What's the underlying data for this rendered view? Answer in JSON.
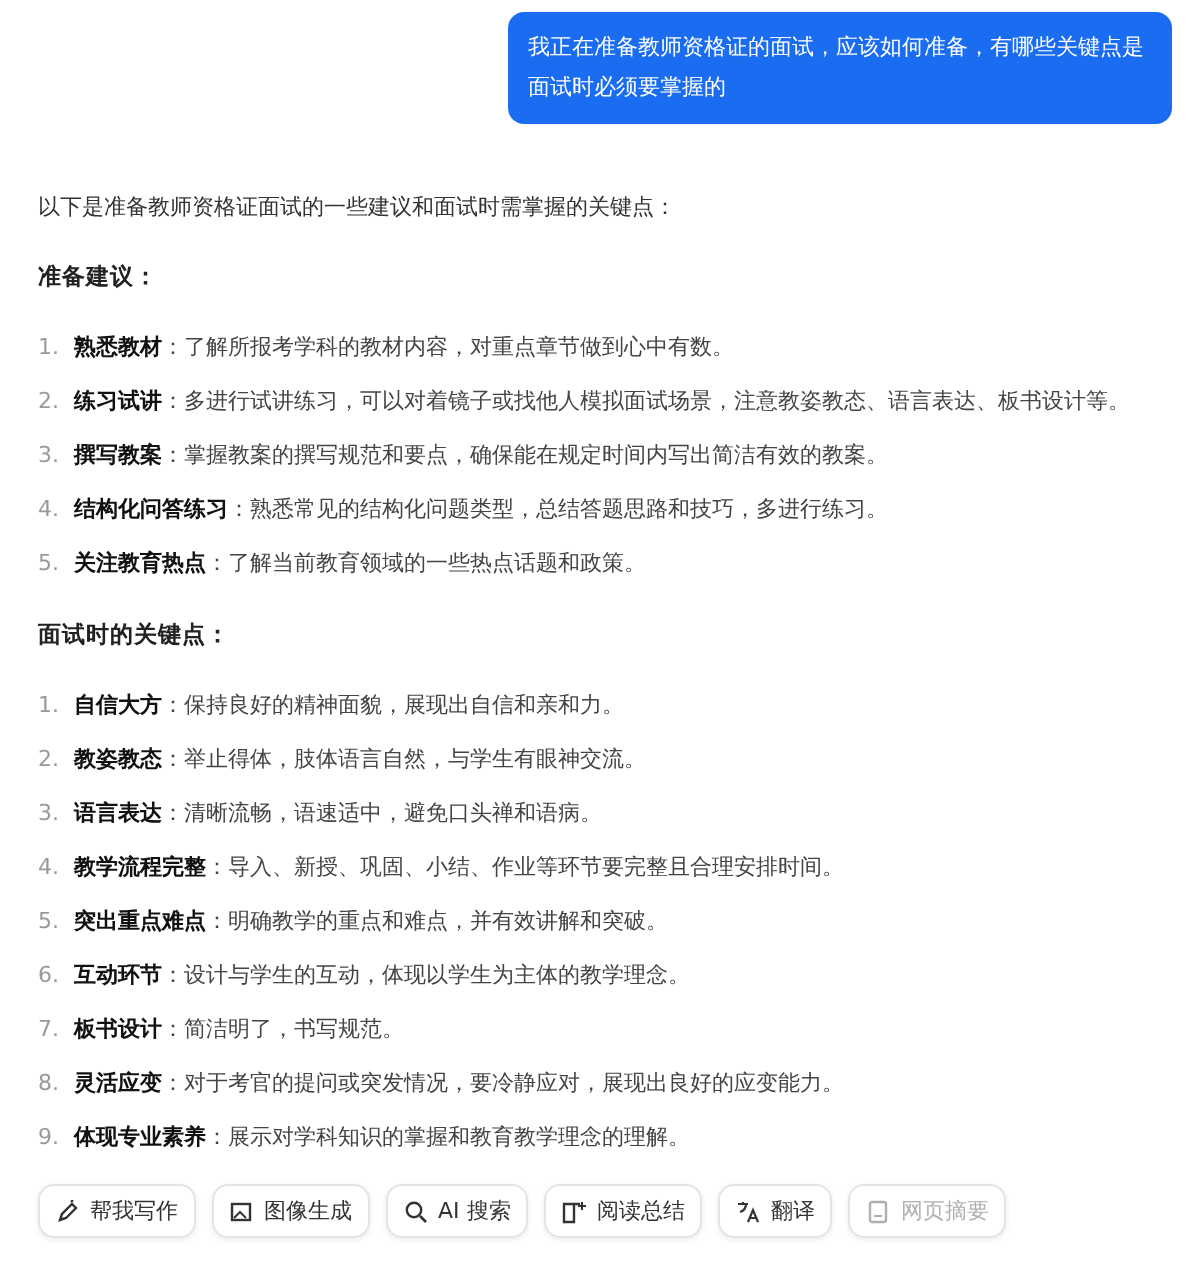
{
  "user_message": "我正在准备教师资格证的面试，应该如何准备，有哪些关键点是面试时必须要掌握的",
  "intro": "以下是准备教师资格证面试的一些建议和面试时需掌握的关键点：",
  "sections": [
    {
      "heading": "准备建议：",
      "items": [
        {
          "number": "1.",
          "term": "熟悉教材",
          "text": "：了解所报考学科的教材内容，对重点章节做到心中有数。"
        },
        {
          "number": "2.",
          "term": "练习试讲",
          "text": "：多进行试讲练习，可以对着镜子或找他人模拟面试场景，注意教姿教态、语言表达、板书设计等。"
        },
        {
          "number": "3.",
          "term": "撰写教案",
          "text": "：掌握教案的撰写规范和要点，确保能在规定时间内写出简洁有效的教案。"
        },
        {
          "number": "4.",
          "term": "结构化问答练习",
          "text": "：熟悉常见的结构化问题类型，总结答题思路和技巧，多进行练习。"
        },
        {
          "number": "5.",
          "term": "关注教育热点",
          "text": "：了解当前教育领域的一些热点话题和政策。"
        }
      ]
    },
    {
      "heading": "面试时的关键点：",
      "items": [
        {
          "number": "1.",
          "term": "自信大方",
          "text": "：保持良好的精神面貌，展现出自信和亲和力。"
        },
        {
          "number": "2.",
          "term": "教姿教态",
          "text": "：举止得体，肢体语言自然，与学生有眼神交流。"
        },
        {
          "number": "3.",
          "term": "语言表达",
          "text": "：清晰流畅，语速适中，避免口头禅和语病。"
        },
        {
          "number": "4.",
          "term": "教学流程完整",
          "text": "：导入、新授、巩固、小结、作业等环节要完整且合理安排时间。"
        },
        {
          "number": "5.",
          "term": "突出重点难点",
          "text": "：明确教学的重点和难点，并有效讲解和突破。"
        },
        {
          "number": "6.",
          "term": "互动环节",
          "text": "：设计与学生的互动，体现以学生为主体的教学理念。"
        },
        {
          "number": "7.",
          "term": "板书设计",
          "text": "：简洁明了，书写规范。"
        },
        {
          "number": "8.",
          "term": "灵活应变",
          "text": "：对于考官的提问或突发情况，要冷静应对，展现出良好的应变能力。"
        },
        {
          "number": "9.",
          "term": "体现专业素养",
          "text": "：展示对学科知识的掌握和教育教学理念的理解。"
        }
      ]
    }
  ],
  "toolbar": [
    {
      "kind": "write",
      "label": "帮我写作",
      "disabled": false
    },
    {
      "kind": "image",
      "label": "图像生成",
      "disabled": false
    },
    {
      "kind": "search",
      "label": "AI 搜索",
      "disabled": false
    },
    {
      "kind": "read",
      "label": "阅读总结",
      "disabled": false
    },
    {
      "kind": "translate",
      "label": "翻译",
      "disabled": false
    },
    {
      "kind": "page",
      "label": "网页摘要",
      "disabled": true
    }
  ]
}
